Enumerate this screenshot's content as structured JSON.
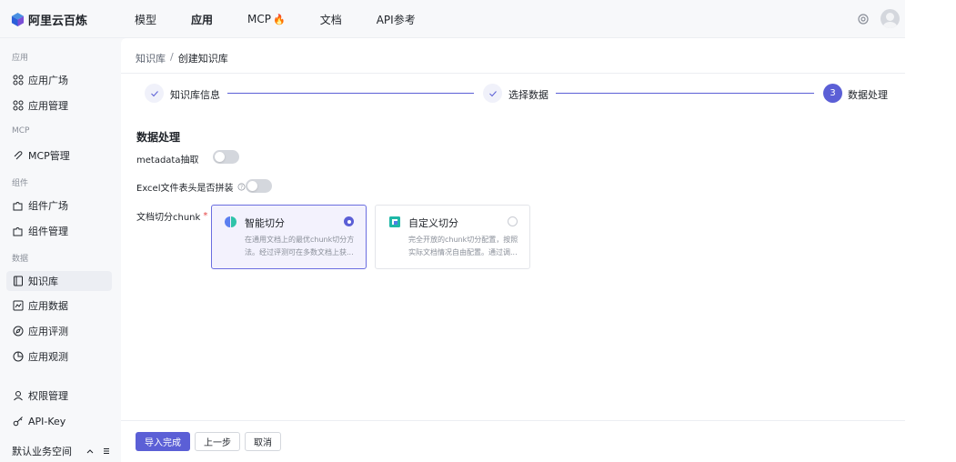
{
  "brand": {
    "name": "阿里云百炼"
  },
  "topnav": [
    {
      "label": "模型"
    },
    {
      "label": "应用"
    },
    {
      "label": "MCP",
      "badge": "🔥"
    },
    {
      "label": "文档"
    },
    {
      "label": "API参考"
    }
  ],
  "sidebar": {
    "sections": [
      {
        "title": "应用",
        "items": [
          {
            "label": "应用广场",
            "icon": "app-grid-icon"
          },
          {
            "label": "应用管理",
            "icon": "app-grid-icon"
          }
        ]
      },
      {
        "title": "MCP",
        "items": [
          {
            "label": "MCP管理",
            "icon": "mcp-icon"
          }
        ]
      },
      {
        "title": "组件",
        "items": [
          {
            "label": "组件广场",
            "icon": "puzzle-icon"
          },
          {
            "label": "组件管理",
            "icon": "puzzle-icon"
          }
        ]
      },
      {
        "title": "数据",
        "items": [
          {
            "label": "知识库",
            "icon": "book-icon"
          },
          {
            "label": "应用数据",
            "icon": "chart-icon"
          },
          {
            "label": "应用评测",
            "icon": "compass-icon"
          },
          {
            "label": "应用观测",
            "icon": "pie-icon"
          }
        ]
      },
      {
        "title": "",
        "items": [
          {
            "label": "权限管理",
            "icon": "user-icon"
          },
          {
            "label": "API-Key",
            "icon": "key-icon"
          }
        ]
      }
    ],
    "workspace": "默认业务空间"
  },
  "breadcrumb": {
    "parent": "知识库",
    "separator": "/",
    "current": "创建知识库"
  },
  "steps": [
    {
      "label": "知识库信息",
      "status": "done"
    },
    {
      "label": "选择数据",
      "status": "done"
    },
    {
      "label": "数据处理",
      "status": "current",
      "number": "3"
    }
  ],
  "form": {
    "heading": "数据处理",
    "metadata_label": "metadata抽取",
    "metadata_enabled": false,
    "excel_label": "Excel文件表头是否拼装",
    "excel_enabled": false,
    "chunk_label": "文档切分chunk",
    "chunk_required_mark": "*",
    "cards": [
      {
        "title": "智能切分",
        "desc_line1": "在通用文档上的最优chunk切分方",
        "desc_line2": "法。经过评测可在多数文档上获...",
        "selected": true
      },
      {
        "title": "自定义切分",
        "desc_line1": "完全开放的chunk切分配置，按照",
        "desc_line2": "实际文档情况自由配置。通过调...",
        "selected": false
      }
    ]
  },
  "footer": {
    "finish_label": "导入完成",
    "prev_label": "上一步",
    "cancel_label": "取消"
  },
  "colors": {
    "primary": "#5b5fd6",
    "sidebar_bg": "#f7f8fa",
    "required": "#e54545"
  }
}
